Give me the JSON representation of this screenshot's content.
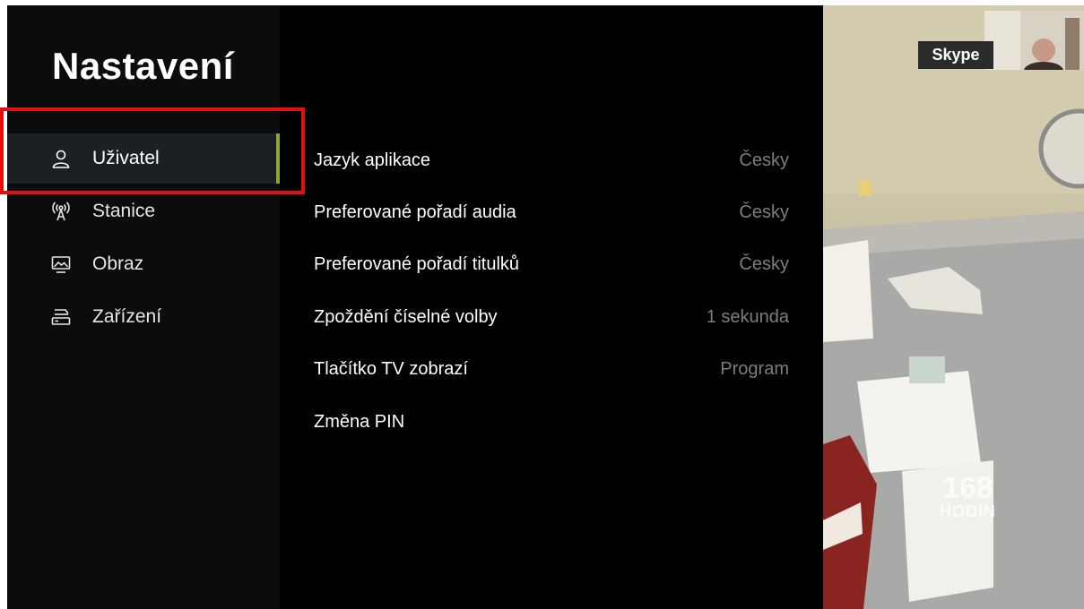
{
  "settings_page": {
    "title": "Nastavení",
    "nav_items": [
      {
        "label": "Uživatel",
        "icon": "user-icon"
      },
      {
        "label": "Stanice",
        "icon": "antenna-icon"
      },
      {
        "label": "Obraz",
        "icon": "picture-icon"
      },
      {
        "label": "Zařízení",
        "icon": "set-top-box-icon"
      }
    ],
    "settings": [
      {
        "label": "Jazyk aplikace",
        "value": "Česky"
      },
      {
        "label": "Preferované pořadí audia",
        "value": "Česky"
      },
      {
        "label": "Preferované pořadí titulků",
        "value": "Česky"
      },
      {
        "label": "Zpoždění číselné volby",
        "value": "1 sekunda"
      },
      {
        "label": "Tlačítko TV zobrazí",
        "value": "Program"
      },
      {
        "label": "Změna PIN",
        "value": ""
      }
    ]
  },
  "overlay": {
    "skype_label": "Skype",
    "watermark_number": "168",
    "watermark_word": "HODIN"
  },
  "colors": {
    "accent": "#8fa82e",
    "highlight_box": "#e41010",
    "background": "#000000",
    "muted_text": "#7d7d7d"
  }
}
